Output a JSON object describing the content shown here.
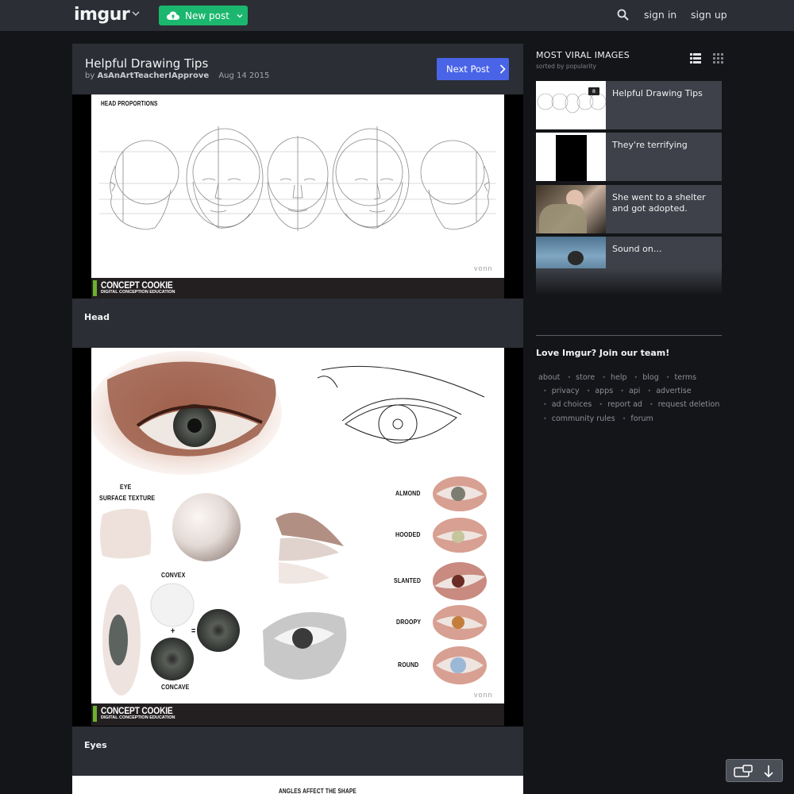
{
  "topbar": {
    "logo": "imgur",
    "new_post_label": "New post",
    "sign_in": "sign in",
    "sign_up": "sign up"
  },
  "post": {
    "title": "Helpful Drawing Tips",
    "by": "by",
    "author": "AsAnArtTeacherIApprove",
    "date": "Aug 14 2015",
    "next_label": "Next Post",
    "images": [
      {
        "heading": "HEAD PROPORTIONS",
        "brand": "CONCEPT COOKIE",
        "brand_sub": "DIGITAL CONCEPTION EDUCATION",
        "watermark": "vonn",
        "caption": "Head"
      },
      {
        "labels": {
          "eye_surface_1": "EYE",
          "eye_surface_2": "SURFACE TEXTURE",
          "convex": "CONVEX",
          "concave": "CONCAVE",
          "plus": "+",
          "equals": "=",
          "almond": "ALMOND",
          "hooded": "HOODED",
          "slanted": "SLANTED",
          "droopy": "DROOPY",
          "round": "ROUND"
        },
        "brand": "CONCEPT COOKIE",
        "brand_sub": "DIGITAL CONCEPTION EDUCATION",
        "watermark": "vonn",
        "caption": "Eyes"
      },
      {
        "heading": "ANGLES AFFECT THE SHAPE"
      }
    ]
  },
  "sidebar": {
    "title": "MOST VIRAL IMAGES",
    "subtitle": "sorted by popularity",
    "items": [
      {
        "title": "Helpful Drawing Tips",
        "count": "8"
      },
      {
        "title": "They're terrifying"
      },
      {
        "title": "She went to a shelter and got adopted."
      },
      {
        "title": "Sound on..."
      }
    ],
    "join": "Love Imgur? Join our team!",
    "footer_links": [
      "about",
      "store",
      "help",
      "blog",
      "terms",
      "privacy",
      "apps",
      "api",
      "advertise",
      "ad choices",
      "report ad",
      "request deletion",
      "community rules",
      "forum"
    ]
  },
  "colors": {
    "topbar": "#2b2e34",
    "new_post": "#1bb76e",
    "next_post": "#4a64e7",
    "background": "#141518",
    "brand_green": "#6ab22f"
  }
}
